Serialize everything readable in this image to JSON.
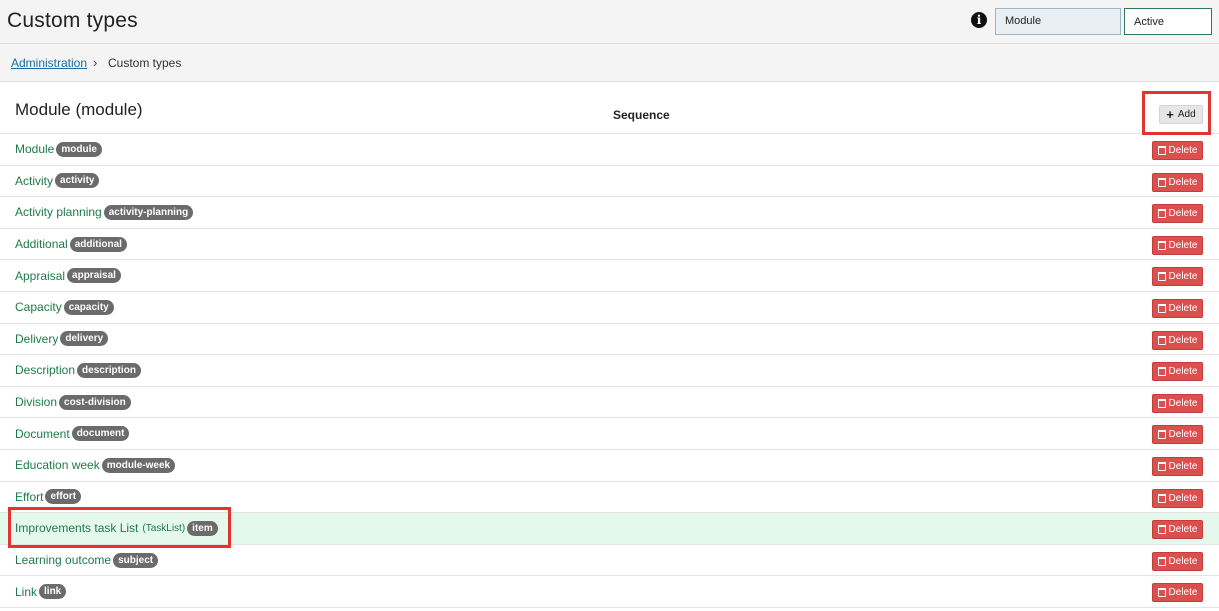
{
  "header": {
    "title": "Custom types",
    "info_icon": "info-circle-icon",
    "module_select": "Module",
    "status_select": "Active"
  },
  "breadcrumb": {
    "root": "Administration",
    "separator": "›",
    "current": "Custom types"
  },
  "section": {
    "title": "Module (module)",
    "column_sequence": "Sequence",
    "add_label": "Add"
  },
  "rows": [
    {
      "name": "Module",
      "tag": "module"
    },
    {
      "name": "Activity",
      "tag": "activity"
    },
    {
      "name": "Activity planning",
      "tag": "activity-planning"
    },
    {
      "name": "Additional",
      "tag": "additional"
    },
    {
      "name": "Appraisal",
      "tag": "appraisal"
    },
    {
      "name": "Capacity",
      "tag": "capacity"
    },
    {
      "name": "Delivery",
      "tag": "delivery"
    },
    {
      "name": "Description",
      "tag": "description"
    },
    {
      "name": "Division",
      "tag": "cost-division"
    },
    {
      "name": "Document",
      "tag": "document"
    },
    {
      "name": "Education week",
      "tag": "module-week"
    },
    {
      "name": "Effort",
      "tag": "effort"
    },
    {
      "name": "Improvements task List",
      "suffix": "(TaskList)",
      "tag": "item",
      "highlighted": true
    },
    {
      "name": "Learning outcome",
      "tag": "subject"
    },
    {
      "name": "Link",
      "tag": "link"
    }
  ],
  "delete_label": "Delete",
  "colors": {
    "link_green": "#1f7a4a",
    "delete_red": "#dc4f4f",
    "highlight_red": "#e3342f",
    "row_highlight": "#e4f8ec",
    "tag_gray": "#6b6b6b"
  }
}
